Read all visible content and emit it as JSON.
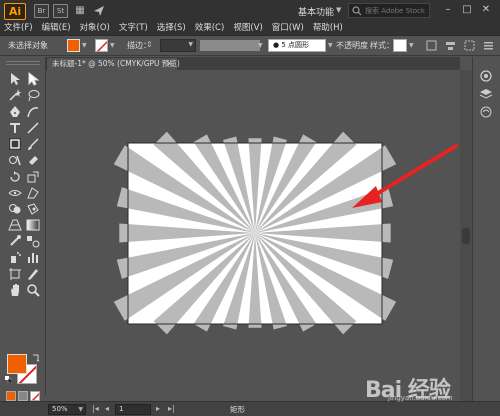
{
  "app": {
    "logo": "Ai",
    "chips": [
      "Br",
      "St"
    ],
    "workspace": "基本功能",
    "search_placeholder": "搜索 Adobe Stock"
  },
  "menu": {
    "items": [
      "文件(F)",
      "编辑(E)",
      "对象(O)",
      "文字(T)",
      "选择(S)",
      "效果(C)",
      "视图(V)",
      "窗口(W)",
      "帮助(H)"
    ]
  },
  "controlbar": {
    "no_selection": "未选择对象",
    "stroke_label": "描边：",
    "brush": "●  5 点圆形",
    "opacity_label": "不透明度",
    "style_label": "样式：",
    "fill_color": "#f06000"
  },
  "document": {
    "tab_title": "未标题-1* @ 50% (CMYK/GPU 预览)",
    "tab_close": "×"
  },
  "statusbar": {
    "zoom": "50%",
    "page": "1",
    "status": "矩形"
  },
  "artwork": {
    "background_color": "#ffffff",
    "ray_color": "#b9b9b9",
    "ray_count": 24,
    "arrow_color": "#e62222"
  },
  "watermark": {
    "logo": "Bai 经验",
    "url": "jingyan.baidu.com"
  }
}
